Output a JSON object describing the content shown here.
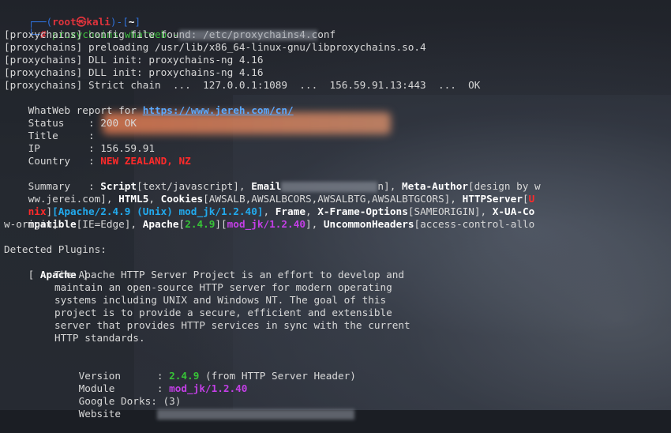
{
  "prompt": {
    "top_prefix": "┌──(",
    "user": "root㉿kali",
    "mid": ")-[",
    "dir": "~",
    "end": "]",
    "bottom_prefix": "└─",
    "symbol": "#",
    "command": "proxychains whatweb -"
  },
  "proxy_lines": [
    "[proxychains] config file found: /etc/proxychains4.conf",
    "[proxychains] preloading /usr/lib/x86_64-linux-gnu/libproxychains.so.4",
    "[proxychains] DLL init: proxychains-ng 4.16",
    "[proxychains] DLL init: proxychains-ng 4.16",
    "[proxychains] Strict chain  ...  127.0.0.1:1089  ...  156.59.91.13:443  ...  OK"
  ],
  "report": {
    "label": "WhatWeb report for ",
    "url": "https://www.jereh.com/cn/",
    "status_label": "Status    : ",
    "status_value": "200 OK",
    "title_label": "Title     : ",
    "ip_label": "IP        : ",
    "ip_value": "156.59.91",
    "country_label": "Country   : ",
    "country_value": "NEW ZEALAND, NZ"
  },
  "summary": {
    "label": "Summary   : ",
    "script": "Script",
    "script_val": "[text/javascript], ",
    "email": "Email",
    "email_tail": "n], ",
    "meta": "Meta-Author",
    "meta_val": "[design by w",
    "line2_pre": "ww.jerei.com], ",
    "html5": "HTML5",
    "sep1": ", ",
    "cookies": "Cookies",
    "cookies_val": "[AWSALB,AWSALBCORS,AWSALBTG,AWSALBTGCORS], ",
    "httpserver": "HTTPServer",
    "bracket_open": "[",
    "unix_part1": "U",
    "unix_part2": "nix",
    "bracket_close": "]",
    "apache_ver": "[Apache/2.4.9 (Unix) mod_jk/1.2.40]",
    "sep2": ", ",
    "frame": "Frame",
    "sep3": ", ",
    "xfo": "X-Frame-Options",
    "xfo_val": "[SAMEORIGIN], ",
    "xua": "X-UA-Co",
    "line4_xua": "mpatible",
    "xua_val": "[IE=Edge], ",
    "apache": "Apache",
    "apache_v1": "2.4.9",
    "apache_v2": "mod_jk/1.2.40",
    "uncommon": "UncommonHeaders",
    "uncommon_val": "[access-control-allo",
    "line5": "w-origin]"
  },
  "plugins": {
    "heading": "Detected Plugins:",
    "plugin_open": "[ ",
    "plugin_name": "Apache",
    "plugin_close": " ]",
    "description": [
      "The Apache HTTP Server Project is an effort to develop and",
      "maintain an open-source HTTP server for modern operating",
      "systems including UNIX and Windows NT. The goal of this",
      "project is to provide a secure, efficient and extensible",
      "server that provides HTTP services in sync with the current",
      "HTTP standards."
    ],
    "version_label": "Version      : ",
    "version_value": "2.4.9",
    "version_note": " (from HTTP Server Header)",
    "module_label": "Module       : ",
    "module_value": "mod_jk/1.2.40",
    "dorks_label": "Google Dorks: ",
    "dorks_value": "(3)",
    "website_label": "Website      "
  },
  "colors": {
    "prompt_blue": "#2f6fd6",
    "prompt_red": "#e0333c",
    "link": "#5aa9ff",
    "red": "#ff2a2a",
    "green": "#37c337",
    "purple": "#c33fe6",
    "cyan": "#22aaee"
  }
}
